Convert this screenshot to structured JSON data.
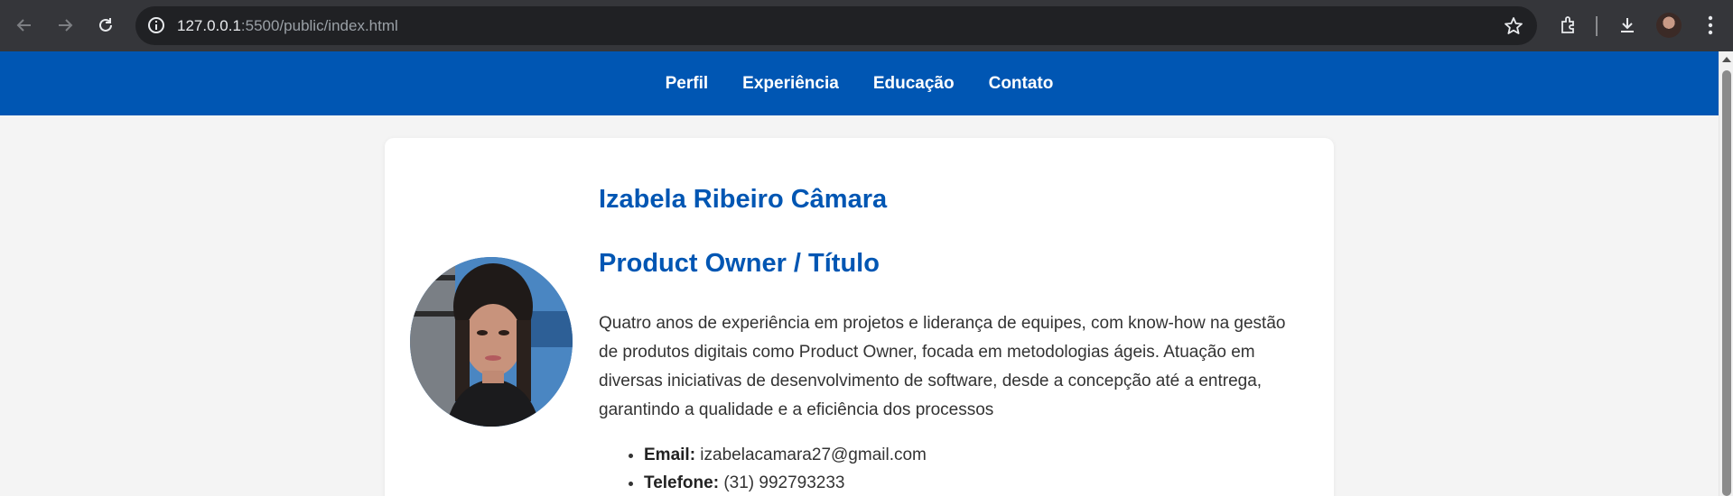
{
  "browser": {
    "url_host": "127.0.0.1",
    "url_rest": ":5500/public/index.html",
    "icons": [
      "back-icon",
      "forward-icon",
      "reload-icon",
      "site-info-icon",
      "bookmark-star-icon",
      "extensions-icon",
      "download-icon",
      "profile-avatar",
      "kebab-menu-icon"
    ]
  },
  "nav": {
    "items": [
      "Perfil",
      "Experiência",
      "Educação",
      "Contato"
    ]
  },
  "profile": {
    "name": "Izabela Ribeiro Câmara",
    "role": "Product Owner / Título",
    "bio": "Quatro anos de experiência em projetos e liderança de equipes, com know-how na gestão de produtos digitais como Product Owner, focada em metodologias ágeis. Atuação em diversas iniciativas de desenvolvimento de software, desde a concepção até a entrega, garantindo a qualidade e a eficiência dos processos",
    "contacts": [
      {
        "label": "Email:",
        "value": " izabelacamara27@gmail.com"
      },
      {
        "label": "Telefone:",
        "value": " (31) 992793233"
      }
    ]
  },
  "colors": {
    "brand": "#0056b3",
    "background": "#f4f4f4",
    "chrome": "#35363a"
  }
}
